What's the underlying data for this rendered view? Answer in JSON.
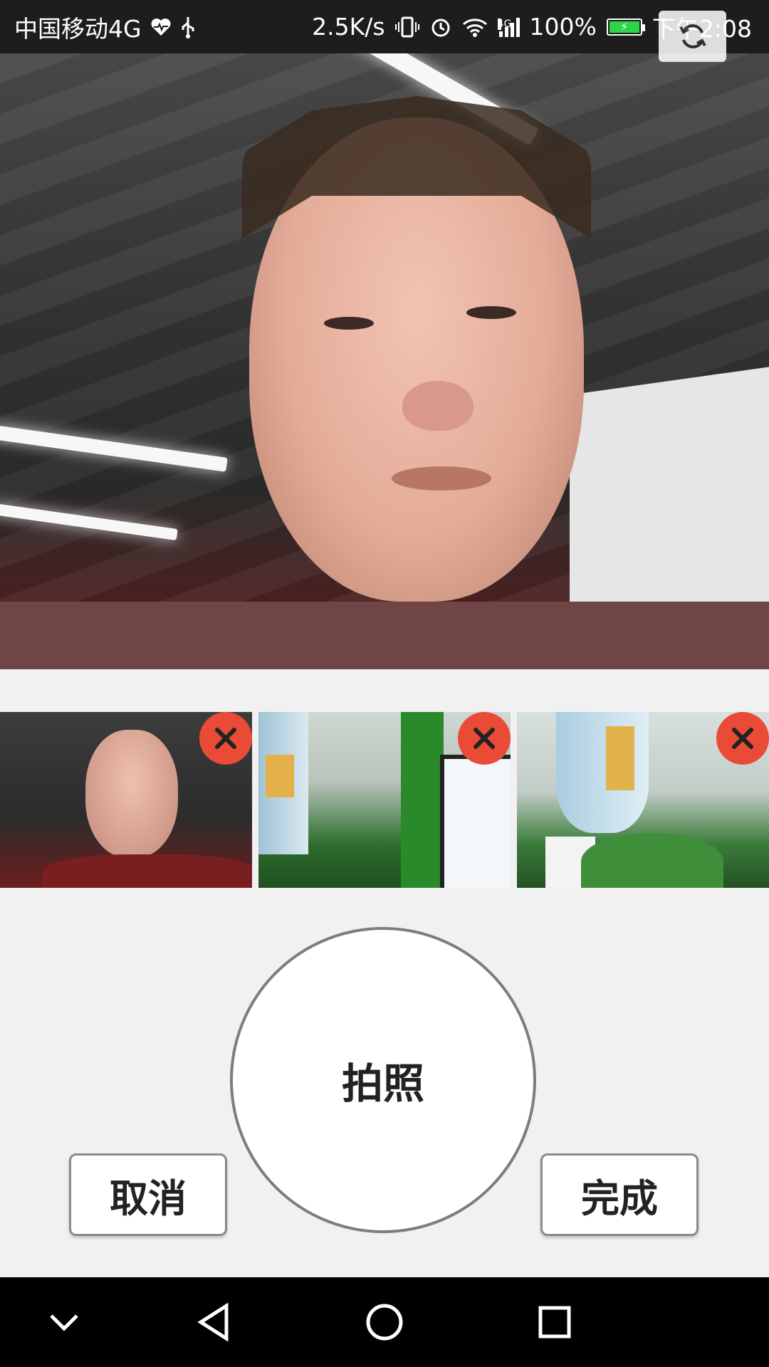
{
  "status_bar": {
    "carrier": "中国移动4G",
    "speed": "2.5K/s",
    "signal_tag": "4G",
    "battery": "100%",
    "time": "下午2:08"
  },
  "icons": {
    "heart": "heart-pulse-icon",
    "usb": "usb-icon",
    "vibrate": "vibrate-icon",
    "alarm": "alarm-icon",
    "wifi": "wifi-icon",
    "signal": "signal-icon",
    "battery": "battery-icon",
    "switch_camera": "switch-camera-icon",
    "delete": "close-icon"
  },
  "thumbnails": [
    {
      "subject": "selfie"
    },
    {
      "subject": "office"
    },
    {
      "subject": "office-water-dispenser"
    }
  ],
  "controls": {
    "shutter_label": "拍照",
    "cancel_label": "取消",
    "done_label": "完成"
  },
  "colors": {
    "delete_badge": "#e94b36",
    "battery_fill": "#2fd34a",
    "background": "#f1f1f1"
  }
}
